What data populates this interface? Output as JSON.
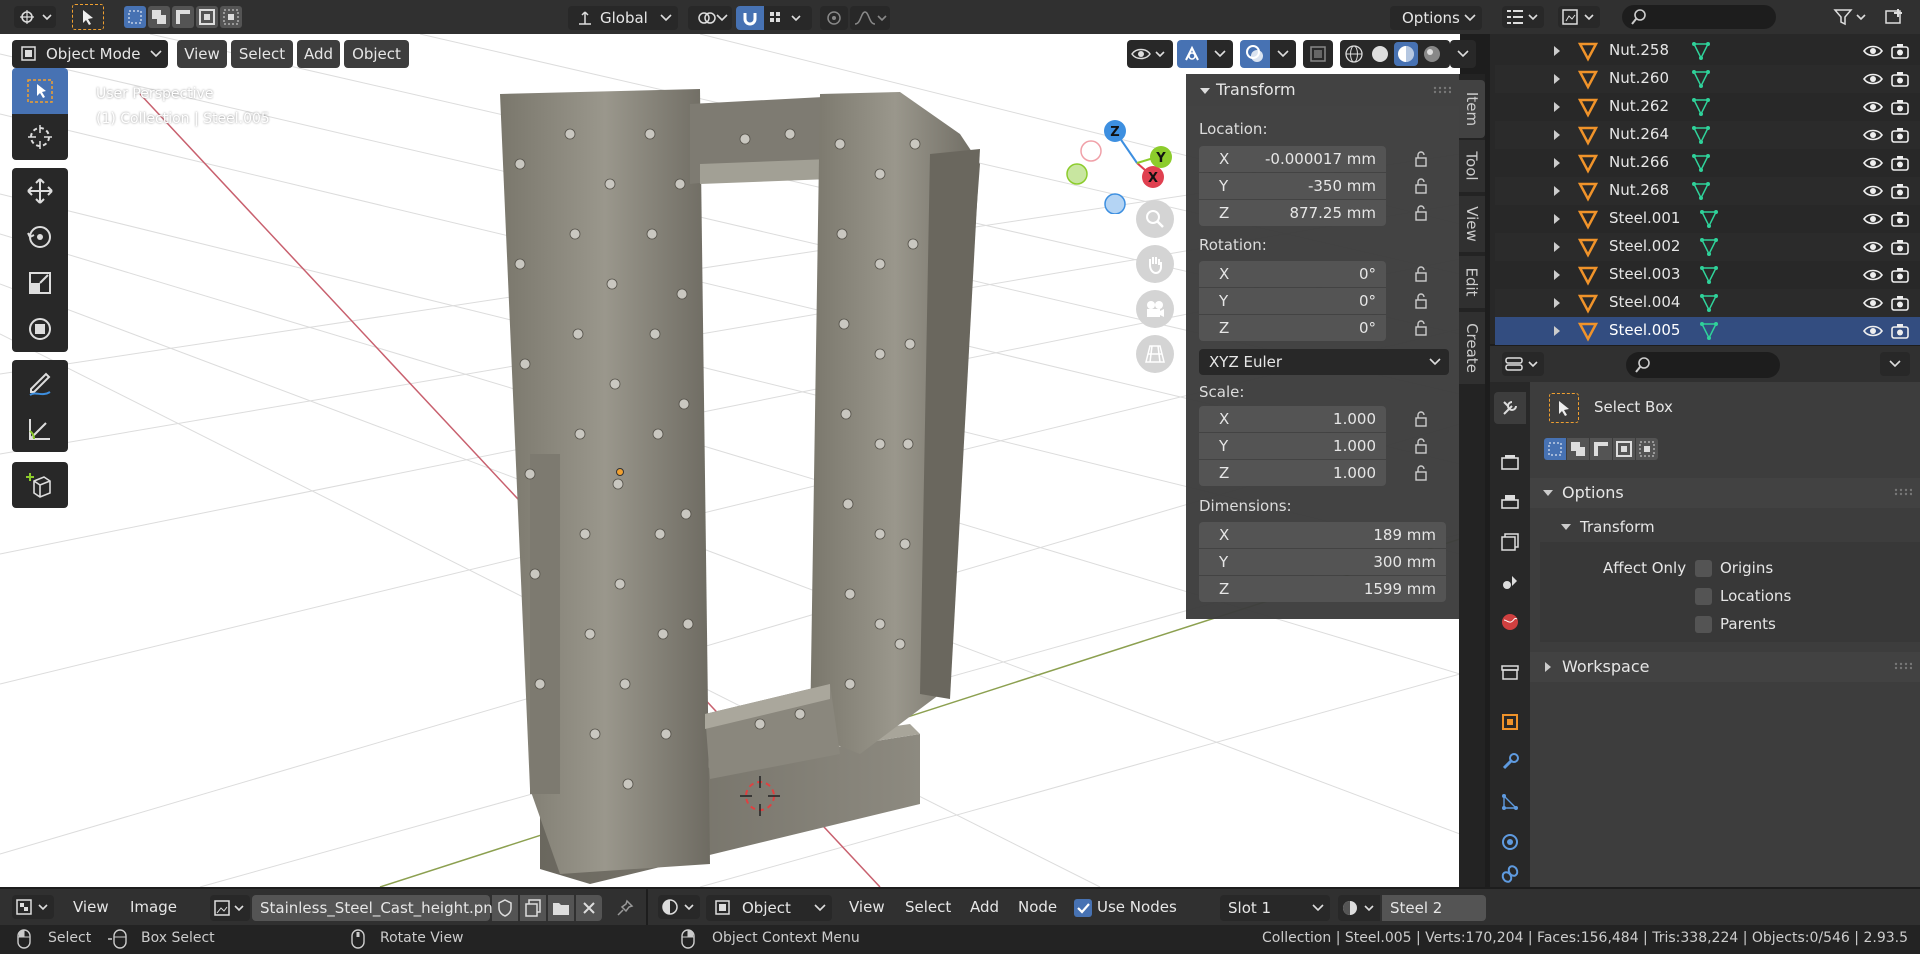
{
  "top_header": {
    "transform_orientation": "Global",
    "options_label": "Options"
  },
  "viewport_header": {
    "mode": "Object Mode",
    "menus": [
      "View",
      "Select",
      "Add",
      "Object"
    ]
  },
  "viewport": {
    "view_name": "User Perspective",
    "collection_info": "(1) Collection | Steel.005",
    "gizmo_axes": [
      "Z",
      "Y",
      "X"
    ]
  },
  "transform_panel": {
    "title": "Transform",
    "location_label": "Location:",
    "location": [
      {
        "axis": "X",
        "value": "-0.000017 mm"
      },
      {
        "axis": "Y",
        "value": "-350 mm"
      },
      {
        "axis": "Z",
        "value": "877.25 mm"
      }
    ],
    "rotation_label": "Rotation:",
    "rotation": [
      {
        "axis": "X",
        "value": "0°"
      },
      {
        "axis": "Y",
        "value": "0°"
      },
      {
        "axis": "Z",
        "value": "0°"
      }
    ],
    "rotation_mode": "XYZ Euler",
    "scale_label": "Scale:",
    "scale": [
      {
        "axis": "X",
        "value": "1.000"
      },
      {
        "axis": "Y",
        "value": "1.000"
      },
      {
        "axis": "Z",
        "value": "1.000"
      }
    ],
    "dimensions_label": "Dimensions:",
    "dimensions": [
      {
        "axis": "X",
        "value": "189 mm"
      },
      {
        "axis": "Y",
        "value": "300 mm"
      },
      {
        "axis": "Z",
        "value": "1599 mm"
      }
    ]
  },
  "sidebar_tabs": [
    "Item",
    "Tool",
    "View",
    "Edit",
    "Create"
  ],
  "outliner": {
    "items": [
      "Nut.258",
      "Nut.260",
      "Nut.262",
      "Nut.264",
      "Nut.266",
      "Nut.268",
      "Steel.001",
      "Steel.002",
      "Steel.003",
      "Steel.004",
      "Steel.005"
    ]
  },
  "properties": {
    "tool_name": "Select Box",
    "options_label": "Options",
    "transform_label": "Transform",
    "affect_only_label": "Affect Only",
    "checkboxes": [
      "Origins",
      "Locations",
      "Parents"
    ],
    "workspace_label": "Workspace"
  },
  "image_editor_header": {
    "menus": [
      "View",
      "Image"
    ],
    "image_name": "Stainless_Steel_Cast_height.png"
  },
  "shader_header": {
    "object_label": "Object",
    "menus": [
      "View",
      "Select",
      "Add",
      "Node"
    ],
    "use_nodes_label": "Use Nodes",
    "slot": "Slot 1",
    "material": "Steel 2"
  },
  "status_bar": {
    "select": "Select",
    "box_select": "Box Select",
    "rotate_view": "Rotate View",
    "context_menu": "Object Context Menu",
    "stats": "Collection | Steel.005 | Verts:170,204 | Faces:156,484 | Tris:338,224 | Objects:0/546 | 2.93.5"
  },
  "colors": {
    "accent": "#4772b3",
    "background": "#303030",
    "viewport": "#ffffff",
    "axis_x": "#e04050",
    "axis_y": "#8ccc2c",
    "axis_z": "#3d8fe0"
  }
}
